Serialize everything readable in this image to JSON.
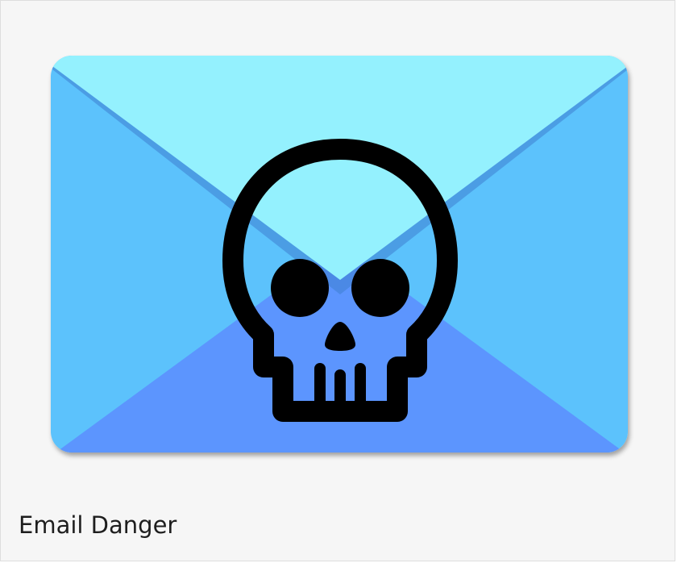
{
  "caption": {
    "title": "Email Danger"
  },
  "icon": {
    "name": "email-danger-icon",
    "colors": {
      "envelope_side": "#5bc2fc",
      "envelope_top_flap": "#94f1fe",
      "envelope_bottom": "#5b95fe",
      "envelope_shadow": "#3f7fd0",
      "skull_stroke": "#000000",
      "skull_tint": "#3d73c9"
    }
  }
}
